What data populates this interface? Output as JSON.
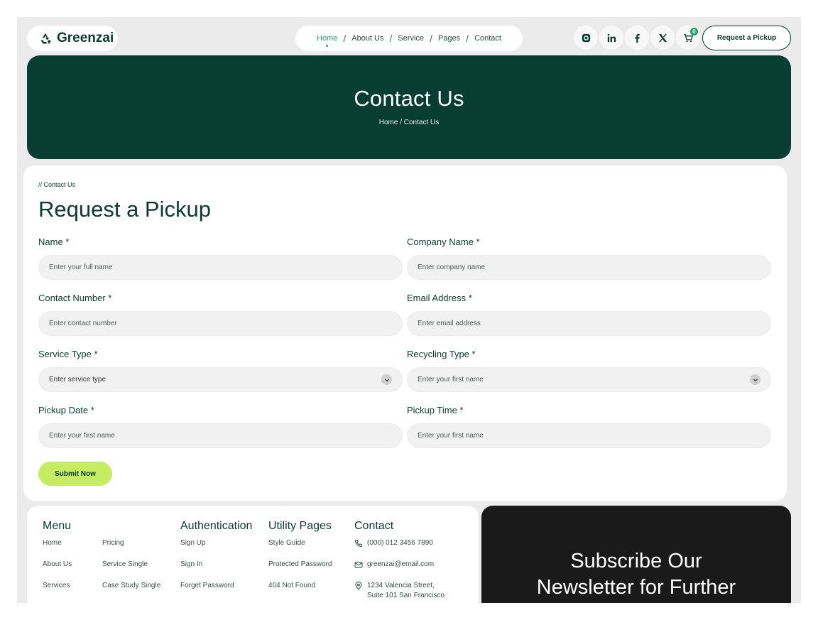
{
  "header": {
    "logo_text": "Greenzai",
    "nav": [
      "Home",
      "About Us",
      "Service",
      "Pages",
      "Contact"
    ],
    "nav_separator": "/",
    "cart_count": "0",
    "cta_label": "Request a Pickup"
  },
  "hero": {
    "title": "Contact Us",
    "breadcrumb": "Home / Contact Us"
  },
  "form": {
    "eyebrow": "// Contact Us",
    "title": "Request a Pickup",
    "fields": {
      "name": {
        "label": "Name *",
        "placeholder": "Enter your full name"
      },
      "company": {
        "label": "Company Name *",
        "placeholder": "Enter company name"
      },
      "contact_number": {
        "label": "Contact Number *",
        "placeholder": "Enter contact number"
      },
      "email": {
        "label": "Email Address *",
        "placeholder": "Enter email address"
      },
      "service_type": {
        "label": "Service Type *",
        "value": "Enter service type"
      },
      "recycling_type": {
        "label": "Recycling Type *",
        "value": "Enter your first name"
      },
      "pickup_date": {
        "label": "Pickup Date *",
        "placeholder": "Enter your first name"
      },
      "pickup_time": {
        "label": "Pickup Time *",
        "placeholder": "Enter your first name"
      }
    },
    "submit_label": "Submit Now"
  },
  "footer": {
    "menu": {
      "title": "Menu",
      "col1": [
        "Home",
        "About Us",
        "Services"
      ],
      "col2": [
        "Pricing",
        "Service Single",
        "Case Study Single"
      ]
    },
    "auth": {
      "title": "Authentication",
      "items": [
        "Sign Up",
        "Sign In",
        "Forget Password"
      ]
    },
    "utility": {
      "title": "Utility Pages",
      "items": [
        "Style Guide",
        "Protected Password",
        "404 Not Found"
      ]
    },
    "contact": {
      "title": "Contact",
      "phone": "(000) 012 3456 7890",
      "email": "greenzai@email.com",
      "address_line1": "1234 Valencia Street,",
      "address_line2": "Suite 101 San Francisco"
    },
    "newsletter": {
      "line1": "Subscribe Our",
      "line2": "Newsletter for Further"
    }
  },
  "colors": {
    "brand_dark": "#073d32",
    "accent_green": "#22a36b",
    "lime": "#c6ec63",
    "newsletter_bg": "#1a1a1a"
  }
}
